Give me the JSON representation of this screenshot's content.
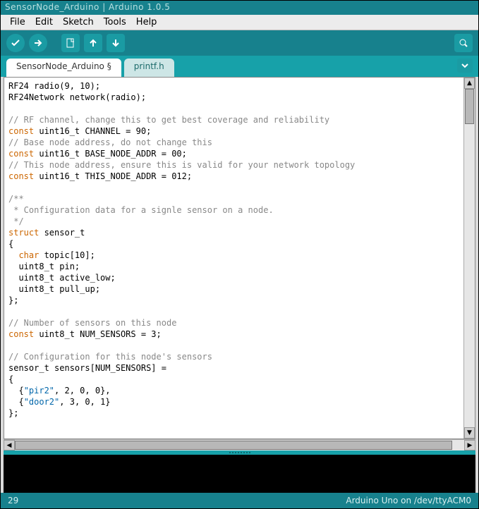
{
  "window_title": "SensorNode_Arduino | Arduino 1.0.5",
  "menu": [
    "File",
    "Edit",
    "Sketch",
    "Tools",
    "Help"
  ],
  "toolbar_icons": [
    "verify",
    "upload",
    "new",
    "open",
    "save",
    "serial-monitor"
  ],
  "tabs": [
    {
      "label": "SensorNode_Arduino §",
      "active": true
    },
    {
      "label": "printf.h",
      "active": false
    }
  ],
  "code_tokens": [
    [
      [
        "",
        "RF24 radio(9, 10);"
      ]
    ],
    [
      [
        "",
        "RF24Network network(radio);"
      ]
    ],
    [
      [
        "",
        ""
      ]
    ],
    [
      [
        "cm",
        "// RF channel, change this to get best coverage and reliability"
      ]
    ],
    [
      [
        "kw",
        "const"
      ],
      [
        "",
        " uint16_t CHANNEL = 90;"
      ]
    ],
    [
      [
        "cm",
        "// Base node address, do not change this"
      ]
    ],
    [
      [
        "kw",
        "const"
      ],
      [
        "",
        " uint16_t BASE_NODE_ADDR = 00;"
      ]
    ],
    [
      [
        "cm",
        "// This node address, ensure this is valid for your network topology"
      ]
    ],
    [
      [
        "kw",
        "const"
      ],
      [
        "",
        " uint16_t THIS_NODE_ADDR = 012;"
      ]
    ],
    [
      [
        "",
        ""
      ]
    ],
    [
      [
        "cm",
        "/**"
      ]
    ],
    [
      [
        "cm",
        " * Configuration data for a signle sensor on a node."
      ]
    ],
    [
      [
        "cm",
        " */"
      ]
    ],
    [
      [
        "kw",
        "struct"
      ],
      [
        "",
        " sensor_t"
      ]
    ],
    [
      [
        "",
        "{"
      ]
    ],
    [
      [
        "",
        "  "
      ],
      [
        "kw",
        "char"
      ],
      [
        "",
        " topic[10];"
      ]
    ],
    [
      [
        "",
        "  uint8_t pin;"
      ]
    ],
    [
      [
        "",
        "  uint8_t active_low;"
      ]
    ],
    [
      [
        "",
        "  uint8_t pull_up;"
      ]
    ],
    [
      [
        "",
        "};"
      ]
    ],
    [
      [
        "",
        ""
      ]
    ],
    [
      [
        "cm",
        "// Number of sensors on this node"
      ]
    ],
    [
      [
        "kw",
        "const"
      ],
      [
        "",
        " uint8_t NUM_SENSORS = 3;"
      ]
    ],
    [
      [
        "",
        ""
      ]
    ],
    [
      [
        "cm",
        "// Configuration for this node's sensors"
      ]
    ],
    [
      [
        "",
        "sensor_t sensors[NUM_SENSORS] ="
      ]
    ],
    [
      [
        "",
        "{"
      ]
    ],
    [
      [
        "",
        "  {"
      ],
      [
        "str",
        "\"pir2\""
      ],
      [
        "",
        ", 2, 0, 0},"
      ]
    ],
    [
      [
        "",
        "  {"
      ],
      [
        "str",
        "\"door2\""
      ],
      [
        "",
        ", 3, 0, 1}"
      ]
    ],
    [
      [
        "",
        "};"
      ]
    ]
  ],
  "status": {
    "line": "29",
    "board": "Arduino Uno on /dev/ttyACM0"
  }
}
